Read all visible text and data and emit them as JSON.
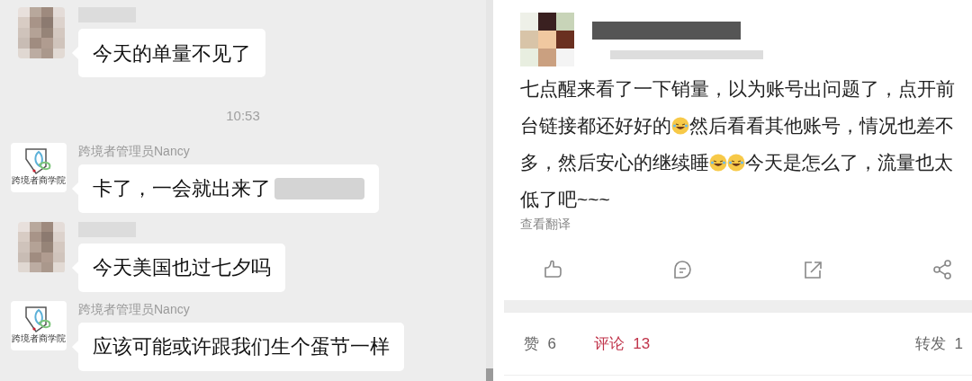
{
  "chat": {
    "items": [
      {
        "kind": "member_message",
        "text": "今天的单量不见了",
        "redacted_tail": false
      },
      {
        "kind": "time",
        "text": "10:53"
      },
      {
        "kind": "admin_message",
        "sender": "跨境者管理员Nancy",
        "avatar_caption": "跨境者商学院",
        "text": "卡了，一会就出来了",
        "redacted_tail": true
      },
      {
        "kind": "member_message",
        "text": "今天美国也过七夕吗",
        "redacted_tail": false
      },
      {
        "kind": "admin_message",
        "sender": "跨境者管理员Nancy",
        "avatar_caption": "跨境者商学院",
        "text": "应该可能或许跟我们生个蛋节一样",
        "redacted_tail": false
      }
    ]
  },
  "post": {
    "body": [
      {
        "kind": "text",
        "text": "七点醒来看了一下销量，以为账号出问题了，点开前台链接都还好好的"
      },
      {
        "kind": "emoji"
      },
      {
        "kind": "text",
        "text": "然后看看其他账号，情况也差不多，然后安心的继续睡"
      },
      {
        "kind": "emoji"
      },
      {
        "kind": "emoji"
      },
      {
        "kind": "text",
        "text": "今天是怎么了，流量也太低了吧~~~"
      }
    ],
    "translate_link": "查看翻译",
    "stats": [
      {
        "label": "赞",
        "count": "6",
        "selected": false
      },
      {
        "label": "评论",
        "count": "13",
        "selected": true
      },
      {
        "label": "转发",
        "count": "1",
        "selected": false
      }
    ]
  }
}
